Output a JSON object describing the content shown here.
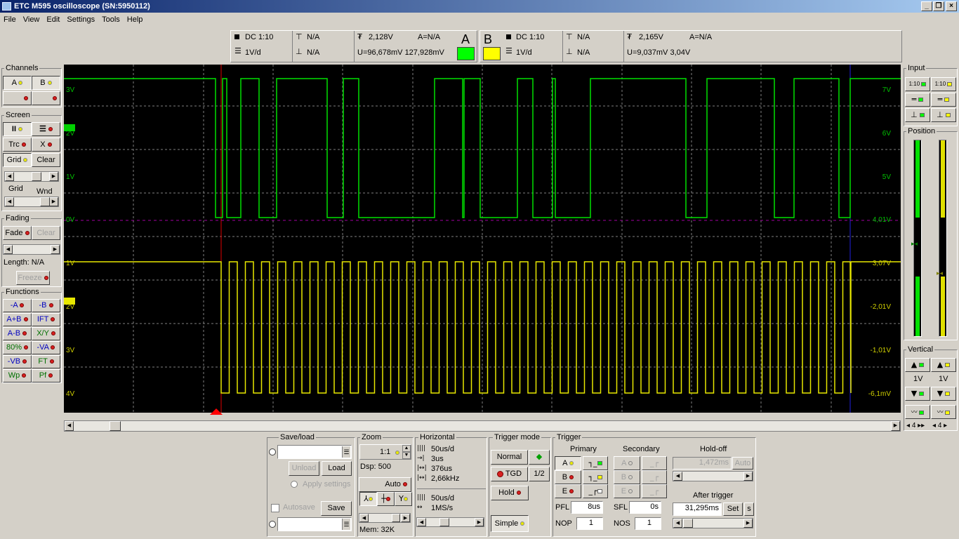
{
  "window": {
    "title": "ETC M595 oscilloscope (SN:5950112)"
  },
  "menu": [
    "File",
    "View",
    "Edit",
    "Settings",
    "Tools",
    "Help"
  ],
  "channel_a": {
    "letter": "A",
    "coupling": "DC 1:10",
    "scale": "1V/d",
    "trig_level": "N/A",
    "trig_level2": "N/A",
    "level": "2,128V",
    "a_eq": "A=N/A",
    "u_meas": "U=96,678mV 127,928mV",
    "color": "#00ff00"
  },
  "channel_b": {
    "letter": "B",
    "coupling": "DC 1:10",
    "scale": "1V/d",
    "trig_level": "N/A",
    "trig_level2": "N/A",
    "level": "2,165V",
    "a_eq": "A=N/A",
    "u_meas": "U=9,037mV 3,04V",
    "color": "#ffff00"
  },
  "left": {
    "channels_title": "Channels",
    "ch_a": "A",
    "ch_b": "B",
    "screen_title": "Screen",
    "trc": "Trc",
    "x": "X",
    "grid": "Grid",
    "clear": "Clear",
    "grid_lbl": "Grid",
    "wnd_lbl": "Wnd",
    "fading_title": "Fading",
    "fade": "Fade",
    "fade_clear": "Clear",
    "length": "Length: N/A",
    "freeze": "Freeze",
    "functions_title": "Functions",
    "functions": [
      [
        "-A",
        "-B"
      ],
      [
        "A+B",
        "IFT"
      ],
      [
        "A-B",
        "X/Y"
      ],
      [
        "80%",
        "-VA"
      ],
      [
        "-VB",
        "FT"
      ],
      [
        "Wp",
        "Pf"
      ]
    ]
  },
  "scope_labels": {
    "left_a": [
      "3V",
      "2V",
      "1V",
      "0V"
    ],
    "left_b": [
      "1V",
      "2V",
      "3V",
      "4V"
    ],
    "right_a": [
      "7V",
      "6V",
      "5V",
      "4,01V"
    ],
    "right_b": [
      "3,07V",
      "-2,01V",
      "-1,01V",
      "-6,1mV"
    ]
  },
  "right": {
    "input_title": "Input",
    "in_a": "1:10",
    "in_b": "1:10",
    "position_title": "Position",
    "vertical_title": "Vertical",
    "va": "1V",
    "vb": "1V",
    "na": "4",
    "nb": "4"
  },
  "saveload": {
    "title": "Save/load",
    "unload": "Unload",
    "load": "Load",
    "apply": "Apply settings",
    "autosave": "Autosave",
    "save": "Save"
  },
  "zoom": {
    "title": "Zoom",
    "value": "1:1",
    "dsp": "Dsp:  500",
    "auto": "Auto",
    "mem": "Mem: 32K"
  },
  "horizontal": {
    "title": "Horizontal",
    "rows": [
      "50us/d",
      "3us",
      "376us",
      "2,66kHz"
    ],
    "rows2": [
      "50us/d",
      "1MS/s"
    ]
  },
  "trigger_mode": {
    "title": "Trigger mode",
    "normal": "Normal",
    "tgd": "TGD",
    "half": "1/2",
    "hold": "Hold",
    "simple": "Simple"
  },
  "trigger": {
    "title": "Trigger",
    "primary": "Primary",
    "secondary": "Secondary",
    "holdoff": "Hold-off",
    "a": "A",
    "b": "B",
    "e": "E",
    "holdoff_value": "1,472ms",
    "auto": "Auto",
    "after_trigger": "After trigger",
    "after_value": "31,295ms",
    "set": "Set",
    "s": "s",
    "pfl": "PFL",
    "pfl_value": "8us",
    "sfl": "SFL",
    "sfl_value": "0s",
    "nop": "NOP",
    "nop_value": "1",
    "nos": "NOS",
    "nos_value": "1"
  }
}
